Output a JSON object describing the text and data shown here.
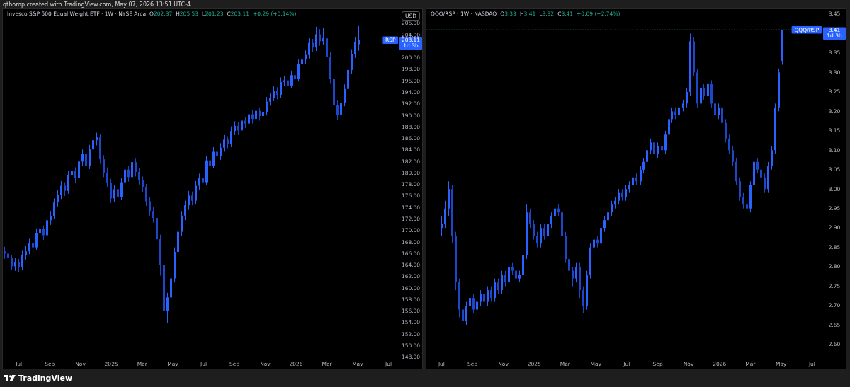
{
  "header": {
    "text": "qthomp created with TradingView.com, May 07, 2026 13:51 UTC-4"
  },
  "panels": [
    {
      "legend": {
        "title": "Invesco S&P 500 Equal Weight ETF · 1W · NYSE Arca",
        "values": [
          {
            "key": "O",
            "value": "202.37"
          },
          {
            "key": "H",
            "value": "205.53"
          },
          {
            "key": "L",
            "value": "201.23"
          },
          {
            "key": "C",
            "value": "203.11"
          }
        ],
        "change": "+0.29 (+0.14%)"
      },
      "currency_button": "USD",
      "price_tag": {
        "symbol": "RSP",
        "price": "203.11",
        "countdown": "1d 3h"
      },
      "chart_data": {
        "type": "candlestick",
        "x": [
          2024.421,
          2024.44,
          2024.459,
          2024.478,
          2024.498,
          2024.517,
          2024.536,
          2024.555,
          2024.574,
          2024.593,
          2024.613,
          2024.632,
          2024.651,
          2024.67,
          2024.689,
          2024.708,
          2024.728,
          2024.747,
          2024.766,
          2024.785,
          2024.804,
          2024.823,
          2024.843,
          2024.862,
          2024.881,
          2024.9,
          2024.919,
          2024.938,
          2024.957,
          2024.977,
          2024.996,
          2025.015,
          2025.034,
          2025.053,
          2025.072,
          2025.092,
          2025.111,
          2025.13,
          2025.149,
          2025.168,
          2025.187,
          2025.207,
          2025.226,
          2025.245,
          2025.264,
          2025.283,
          2025.302,
          2025.322,
          2025.341,
          2025.36,
          2025.379,
          2025.398,
          2025.417,
          2025.436,
          2025.456,
          2025.475,
          2025.494,
          2025.513,
          2025.532,
          2025.551,
          2025.571,
          2025.59,
          2025.609,
          2025.628,
          2025.647,
          2025.666,
          2025.686,
          2025.705,
          2025.724,
          2025.743,
          2025.762,
          2025.781,
          2025.801,
          2025.82,
          2025.839,
          2025.858,
          2025.877,
          2025.896,
          2025.915,
          2025.935,
          2025.954,
          2025.973,
          2025.992,
          2026.011,
          2026.03,
          2026.05,
          2026.069,
          2026.088,
          2026.107,
          2026.126,
          2026.145,
          2026.165,
          2026.184,
          2026.203,
          2026.222,
          2026.241,
          2026.26,
          2026.28,
          2026.299,
          2026.318,
          2026.337
        ],
        "ohlc": [
          [
            166.4,
            167.2,
            165.1,
            166.0
          ],
          [
            166.0,
            166.9,
            164.6,
            165.2
          ],
          [
            165.2,
            165.8,
            163.1,
            163.8
          ],
          [
            163.8,
            165.3,
            163.0,
            164.5
          ],
          [
            164.5,
            165.1,
            162.8,
            163.6
          ],
          [
            163.6,
            166.5,
            163.1,
            165.8
          ],
          [
            165.8,
            167.3,
            165.0,
            166.4
          ],
          [
            166.4,
            168.6,
            165.9,
            167.9
          ],
          [
            167.9,
            168.5,
            166.2,
            167.1
          ],
          [
            167.1,
            170.4,
            166.6,
            169.6
          ],
          [
            169.6,
            171.2,
            168.8,
            170.3
          ],
          [
            170.3,
            170.9,
            168.4,
            169.2
          ],
          [
            169.2,
            172.5,
            168.7,
            171.8
          ],
          [
            171.8,
            173.4,
            171.0,
            172.5
          ],
          [
            172.5,
            175.6,
            172.0,
            174.9
          ],
          [
            174.9,
            177.1,
            174.2,
            176.2
          ],
          [
            176.2,
            178.6,
            175.5,
            177.8
          ],
          [
            177.8,
            178.4,
            176.0,
            176.9
          ],
          [
            176.9,
            180.3,
            176.4,
            179.6
          ],
          [
            179.6,
            181.2,
            178.8,
            180.4
          ],
          [
            180.4,
            181.0,
            178.2,
            179.1
          ],
          [
            179.1,
            182.8,
            178.6,
            182.0
          ],
          [
            182.0,
            184.1,
            181.3,
            183.3
          ],
          [
            183.3,
            183.9,
            180.5,
            181.2
          ],
          [
            181.2,
            184.9,
            180.7,
            184.1
          ],
          [
            184.1,
            186.5,
            183.4,
            185.7
          ],
          [
            185.7,
            187.0,
            184.8,
            186.2
          ],
          [
            186.2,
            186.8,
            181.6,
            182.4
          ],
          [
            182.4,
            183.1,
            179.3,
            180.1
          ],
          [
            180.1,
            181.0,
            177.5,
            178.3
          ],
          [
            178.3,
            179.0,
            174.8,
            175.6
          ],
          [
            175.6,
            178.0,
            175.0,
            177.2
          ],
          [
            177.2,
            177.9,
            175.1,
            175.9
          ],
          [
            175.9,
            179.2,
            175.3,
            178.4
          ],
          [
            178.4,
            181.4,
            177.8,
            180.6
          ],
          [
            180.6,
            181.2,
            178.5,
            179.3
          ],
          [
            179.3,
            182.7,
            178.8,
            181.9
          ],
          [
            181.9,
            182.5,
            179.4,
            180.2
          ],
          [
            180.2,
            180.9,
            178.0,
            178.8
          ],
          [
            178.8,
            179.4,
            176.7,
            177.5
          ],
          [
            177.5,
            178.1,
            174.3,
            175.1
          ],
          [
            175.1,
            175.8,
            172.6,
            173.4
          ],
          [
            173.4,
            174.1,
            171.4,
            172.2
          ],
          [
            172.2,
            173.0,
            167.7,
            168.5
          ],
          [
            168.5,
            169.3,
            162.2,
            164.0
          ],
          [
            164.0,
            164.8,
            150.6,
            156.1
          ],
          [
            156.1,
            159.2,
            153.9,
            158.4
          ],
          [
            158.4,
            162.5,
            157.6,
            161.7
          ],
          [
            161.7,
            167.1,
            161.0,
            166.3
          ],
          [
            166.3,
            170.6,
            165.5,
            169.8
          ],
          [
            169.8,
            173.4,
            169.0,
            172.6
          ],
          [
            172.6,
            175.2,
            171.8,
            174.4
          ],
          [
            174.4,
            176.9,
            173.6,
            176.1
          ],
          [
            176.1,
            176.8,
            174.4,
            175.2
          ],
          [
            175.2,
            178.6,
            174.6,
            177.8
          ],
          [
            177.8,
            179.9,
            177.0,
            179.1
          ],
          [
            179.1,
            179.8,
            177.6,
            178.4
          ],
          [
            178.4,
            183.0,
            177.9,
            182.2
          ],
          [
            182.2,
            182.9,
            180.5,
            181.3
          ],
          [
            181.3,
            184.5,
            180.8,
            183.7
          ],
          [
            183.7,
            184.3,
            182.1,
            182.9
          ],
          [
            182.9,
            185.2,
            182.3,
            184.4
          ],
          [
            184.4,
            186.6,
            183.7,
            185.8
          ],
          [
            185.8,
            186.4,
            184.3,
            185.1
          ],
          [
            185.1,
            188.1,
            184.5,
            187.3
          ],
          [
            187.3,
            189.0,
            186.6,
            188.2
          ],
          [
            188.2,
            188.9,
            186.6,
            187.4
          ],
          [
            187.4,
            189.9,
            186.8,
            189.1
          ],
          [
            189.1,
            189.7,
            187.8,
            188.6
          ],
          [
            188.6,
            191.0,
            188.0,
            190.2
          ],
          [
            190.2,
            190.9,
            188.6,
            189.4
          ],
          [
            189.4,
            191.6,
            188.8,
            190.8
          ],
          [
            190.8,
            191.4,
            189.1,
            189.9
          ],
          [
            189.9,
            191.4,
            189.3,
            190.6
          ],
          [
            190.6,
            193.2,
            190.0,
            192.4
          ],
          [
            192.4,
            193.9,
            191.7,
            193.1
          ],
          [
            193.1,
            195.1,
            192.5,
            194.3
          ],
          [
            194.3,
            194.9,
            192.8,
            193.6
          ],
          [
            193.6,
            196.6,
            193.0,
            195.8
          ],
          [
            195.8,
            196.9,
            195.1,
            196.1
          ],
          [
            196.1,
            196.8,
            194.4,
            195.2
          ],
          [
            195.2,
            197.8,
            194.7,
            197.0
          ],
          [
            197.0,
            197.7,
            195.6,
            196.4
          ],
          [
            196.4,
            199.7,
            195.9,
            198.9
          ],
          [
            198.9,
            200.5,
            198.1,
            199.7
          ],
          [
            199.7,
            201.3,
            199.0,
            200.5
          ],
          [
            200.5,
            203.4,
            199.9,
            202.6
          ],
          [
            202.6,
            203.3,
            201.0,
            201.8
          ],
          [
            201.8,
            205.4,
            201.2,
            204.1
          ],
          [
            204.1,
            205.0,
            202.1,
            202.9
          ],
          [
            202.9,
            205.2,
            202.2,
            203.4
          ],
          [
            203.4,
            204.1,
            199.4,
            200.2
          ],
          [
            200.2,
            201.0,
            195.5,
            196.3
          ],
          [
            196.3,
            197.1,
            191.0,
            191.8
          ],
          [
            191.8,
            192.6,
            189.3,
            190.1
          ],
          [
            190.1,
            193.0,
            188.0,
            192.2
          ],
          [
            192.2,
            195.4,
            191.6,
            194.6
          ],
          [
            194.6,
            198.7,
            194.0,
            197.9
          ],
          [
            197.9,
            201.5,
            197.2,
            200.7
          ],
          [
            200.7,
            203.6,
            200.0,
            202.8
          ],
          [
            202.37,
            205.53,
            201.23,
            203.11
          ]
        ],
        "xlim": [
          2024.413,
          2026.548
        ],
        "ylim": [
          148,
          206
        ],
        "ref_lines": [
          {
            "axis": "y",
            "value": 203.11
          }
        ],
        "xticks": [
          {
            "value": 2024.5,
            "label": "Jul"
          },
          {
            "value": 2024.667,
            "label": "Sep"
          },
          {
            "value": 2024.833,
            "label": "Nov"
          },
          {
            "value": 2025,
            "label": "2025"
          },
          {
            "value": 2025.167,
            "label": "Mar"
          },
          {
            "value": 2025.333,
            "label": "May"
          },
          {
            "value": 2025.5,
            "label": "Jul"
          },
          {
            "value": 2025.667,
            "label": "Sep"
          },
          {
            "value": 2025.833,
            "label": "Nov"
          },
          {
            "value": 2026,
            "label": "2026"
          },
          {
            "value": 2026.167,
            "label": "Mar"
          },
          {
            "value": 2026.333,
            "label": "May"
          },
          {
            "value": 2026.5,
            "label": "Jul"
          }
        ],
        "yticks": [
          {
            "value": 206,
            "label": "206.00"
          },
          {
            "value": 204,
            "label": "204.00"
          },
          {
            "value": 200,
            "label": "200.00"
          },
          {
            "value": 198,
            "label": "198.00"
          },
          {
            "value": 196,
            "label": "196.00"
          },
          {
            "value": 194,
            "label": "194.00"
          },
          {
            "value": 192,
            "label": "192.00"
          },
          {
            "value": 190,
            "label": "190.00"
          },
          {
            "value": 188,
            "label": "188.00"
          },
          {
            "value": 186,
            "label": "186.00"
          },
          {
            "value": 184,
            "label": "184.00"
          },
          {
            "value": 182,
            "label": "182.00"
          },
          {
            "value": 180,
            "label": "180.00"
          },
          {
            "value": 178,
            "label": "178.00"
          },
          {
            "value": 176,
            "label": "176.00"
          },
          {
            "value": 174,
            "label": "174.00"
          },
          {
            "value": 172,
            "label": "172.00"
          },
          {
            "value": 170,
            "label": "170.00"
          },
          {
            "value": 168,
            "label": "168.00"
          },
          {
            "value": 166,
            "label": "166.00"
          },
          {
            "value": 164,
            "label": "164.00"
          },
          {
            "value": 162,
            "label": "162.00"
          },
          {
            "value": 160,
            "label": "160.00"
          },
          {
            "value": 158,
            "label": "158.00"
          },
          {
            "value": 156,
            "label": "156.00"
          },
          {
            "value": 154,
            "label": "154.00"
          },
          {
            "value": 152,
            "label": "152.00"
          },
          {
            "value": 150,
            "label": "150.00"
          },
          {
            "value": 148,
            "label": "148.00"
          }
        ]
      }
    },
    {
      "legend": {
        "title": "QQQ/RSP · 1W · NASDAQ",
        "values": [
          {
            "key": "O",
            "value": "3.33"
          },
          {
            "key": "H",
            "value": "3.41"
          },
          {
            "key": "L",
            "value": "3.32"
          },
          {
            "key": "C",
            "value": "3.41"
          }
        ],
        "change": "+0.09 (+2.74%)"
      },
      "price_tag": {
        "symbol": "QQQ/RSP",
        "price": "3.41",
        "countdown": "1d 3h"
      },
      "chart_data": {
        "type": "candlestick",
        "x": [
          2024.498,
          2024.517,
          2024.536,
          2024.555,
          2024.574,
          2024.593,
          2024.613,
          2024.632,
          2024.651,
          2024.67,
          2024.689,
          2024.708,
          2024.728,
          2024.747,
          2024.766,
          2024.785,
          2024.804,
          2024.823,
          2024.843,
          2024.862,
          2024.881,
          2024.9,
          2024.919,
          2024.938,
          2024.957,
          2024.977,
          2024.996,
          2025.015,
          2025.034,
          2025.053,
          2025.072,
          2025.092,
          2025.111,
          2025.13,
          2025.149,
          2025.168,
          2025.187,
          2025.207,
          2025.226,
          2025.245,
          2025.264,
          2025.283,
          2025.302,
          2025.322,
          2025.341,
          2025.36,
          2025.379,
          2025.398,
          2025.417,
          2025.436,
          2025.456,
          2025.475,
          2025.494,
          2025.513,
          2025.532,
          2025.551,
          2025.571,
          2025.59,
          2025.609,
          2025.628,
          2025.647,
          2025.666,
          2025.686,
          2025.705,
          2025.724,
          2025.743,
          2025.762,
          2025.781,
          2025.801,
          2025.82,
          2025.839,
          2025.858,
          2025.877,
          2025.896,
          2025.915,
          2025.935,
          2025.954,
          2025.973,
          2025.992,
          2026.011,
          2026.03,
          2026.05,
          2026.069,
          2026.088,
          2026.107,
          2026.126,
          2026.145,
          2026.165,
          2026.184,
          2026.203,
          2026.222,
          2026.241,
          2026.26,
          2026.28,
          2026.299,
          2026.318,
          2026.337
        ],
        "ohlc": [
          [
            2.9,
            2.93,
            2.88,
            2.91
          ],
          [
            2.91,
            2.97,
            2.9,
            2.95
          ],
          [
            2.95,
            3.02,
            2.93,
            3.0
          ],
          [
            3.0,
            3.01,
            2.86,
            2.88
          ],
          [
            2.88,
            2.89,
            2.74,
            2.76
          ],
          [
            2.76,
            2.77,
            2.67,
            2.69
          ],
          [
            2.69,
            2.7,
            2.63,
            2.66
          ],
          [
            2.66,
            2.71,
            2.65,
            2.7
          ],
          [
            2.7,
            2.74,
            2.69,
            2.72
          ],
          [
            2.72,
            2.73,
            2.68,
            2.69
          ],
          [
            2.69,
            2.72,
            2.68,
            2.71
          ],
          [
            2.71,
            2.74,
            2.7,
            2.73
          ],
          [
            2.73,
            2.74,
            2.7,
            2.71
          ],
          [
            2.71,
            2.75,
            2.7,
            2.74
          ],
          [
            2.74,
            2.75,
            2.71,
            2.72
          ],
          [
            2.72,
            2.77,
            2.71,
            2.76
          ],
          [
            2.76,
            2.77,
            2.73,
            2.74
          ],
          [
            2.74,
            2.79,
            2.73,
            2.78
          ],
          [
            2.78,
            2.79,
            2.75,
            2.76
          ],
          [
            2.76,
            2.81,
            2.75,
            2.8
          ],
          [
            2.8,
            2.81,
            2.78,
            2.79
          ],
          [
            2.79,
            2.8,
            2.76,
            2.77
          ],
          [
            2.77,
            2.79,
            2.76,
            2.78
          ],
          [
            2.78,
            2.84,
            2.77,
            2.83
          ],
          [
            2.83,
            2.96,
            2.82,
            2.94
          ],
          [
            2.94,
            2.95,
            2.9,
            2.91
          ],
          [
            2.91,
            2.92,
            2.87,
            2.88
          ],
          [
            2.88,
            2.89,
            2.85,
            2.86
          ],
          [
            2.86,
            2.91,
            2.85,
            2.9
          ],
          [
            2.9,
            2.91,
            2.87,
            2.88
          ],
          [
            2.88,
            2.92,
            2.87,
            2.91
          ],
          [
            2.91,
            2.94,
            2.9,
            2.93
          ],
          [
            2.93,
            2.97,
            2.92,
            2.95
          ],
          [
            2.95,
            2.96,
            2.93,
            2.94
          ],
          [
            2.94,
            2.95,
            2.87,
            2.88
          ],
          [
            2.88,
            2.89,
            2.81,
            2.82
          ],
          [
            2.82,
            2.83,
            2.78,
            2.79
          ],
          [
            2.79,
            2.8,
            2.75,
            2.77
          ],
          [
            2.77,
            2.81,
            2.76,
            2.8
          ],
          [
            2.8,
            2.81,
            2.72,
            2.74
          ],
          [
            2.74,
            2.75,
            2.68,
            2.7
          ],
          [
            2.7,
            2.79,
            2.69,
            2.78
          ],
          [
            2.78,
            2.86,
            2.77,
            2.85
          ],
          [
            2.85,
            2.88,
            2.84,
            2.87
          ],
          [
            2.87,
            2.88,
            2.85,
            2.86
          ],
          [
            2.86,
            2.91,
            2.85,
            2.9
          ],
          [
            2.9,
            2.93,
            2.89,
            2.92
          ],
          [
            2.92,
            2.95,
            2.91,
            2.94
          ],
          [
            2.94,
            2.97,
            2.93,
            2.96
          ],
          [
            2.96,
            2.98,
            2.95,
            2.97
          ],
          [
            2.97,
            3.0,
            2.96,
            2.99
          ],
          [
            2.99,
            3.0,
            2.97,
            2.98
          ],
          [
            2.98,
            3.01,
            2.97,
            3.0
          ],
          [
            3.0,
            3.02,
            2.99,
            3.01
          ],
          [
            3.01,
            3.04,
            3.0,
            3.03
          ],
          [
            3.03,
            3.04,
            3.01,
            3.02
          ],
          [
            3.02,
            3.06,
            3.01,
            3.05
          ],
          [
            3.05,
            3.08,
            3.04,
            3.07
          ],
          [
            3.07,
            3.11,
            3.06,
            3.1
          ],
          [
            3.1,
            3.13,
            3.09,
            3.12
          ],
          [
            3.12,
            3.13,
            3.08,
            3.09
          ],
          [
            3.09,
            3.12,
            3.08,
            3.11
          ],
          [
            3.11,
            3.12,
            3.09,
            3.1
          ],
          [
            3.1,
            3.15,
            3.09,
            3.14
          ],
          [
            3.14,
            3.19,
            3.13,
            3.18
          ],
          [
            3.18,
            3.21,
            3.17,
            3.2
          ],
          [
            3.2,
            3.21,
            3.18,
            3.19
          ],
          [
            3.19,
            3.22,
            3.18,
            3.21
          ],
          [
            3.21,
            3.23,
            3.2,
            3.22
          ],
          [
            3.22,
            3.26,
            3.21,
            3.25
          ],
          [
            3.25,
            3.4,
            3.24,
            3.38
          ],
          [
            3.38,
            3.39,
            3.29,
            3.3
          ],
          [
            3.3,
            3.31,
            3.21,
            3.22
          ],
          [
            3.22,
            3.27,
            3.21,
            3.26
          ],
          [
            3.26,
            3.27,
            3.23,
            3.24
          ],
          [
            3.24,
            3.28,
            3.23,
            3.27
          ],
          [
            3.27,
            3.28,
            3.21,
            3.22
          ],
          [
            3.22,
            3.23,
            3.18,
            3.19
          ],
          [
            3.19,
            3.22,
            3.18,
            3.21
          ],
          [
            3.21,
            3.22,
            3.16,
            3.17
          ],
          [
            3.17,
            3.18,
            3.12,
            3.13
          ],
          [
            3.13,
            3.14,
            3.09,
            3.1
          ],
          [
            3.1,
            3.11,
            3.06,
            3.07
          ],
          [
            3.07,
            3.08,
            3.01,
            3.02
          ],
          [
            3.02,
            3.03,
            2.97,
            2.98
          ],
          [
            2.98,
            2.99,
            2.95,
            2.96
          ],
          [
            2.96,
            2.97,
            2.94,
            2.95
          ],
          [
            2.95,
            3.02,
            2.94,
            3.01
          ],
          [
            3.01,
            3.08,
            3.0,
            3.07
          ],
          [
            3.07,
            3.08,
            3.04,
            3.05
          ],
          [
            3.05,
            3.06,
            3.02,
            3.03
          ],
          [
            3.03,
            3.04,
            2.99,
            3.0
          ],
          [
            3.0,
            3.07,
            2.99,
            3.06
          ],
          [
            3.06,
            3.11,
            3.05,
            3.1
          ],
          [
            3.1,
            3.22,
            3.09,
            3.21
          ],
          [
            3.21,
            3.31,
            3.2,
            3.3
          ],
          [
            3.33,
            3.41,
            3.32,
            3.41
          ]
        ],
        "xlim": [
          2024.418,
          2026.548
        ],
        "ylim": [
          2.6,
          3.45
        ],
        "ref_lines": [
          {
            "axis": "y",
            "value": 3.41
          }
        ],
        "xticks": [
          {
            "value": 2024.5,
            "label": "Jul"
          },
          {
            "value": 2024.667,
            "label": "Sep"
          },
          {
            "value": 2024.833,
            "label": "Nov"
          },
          {
            "value": 2025,
            "label": "2025"
          },
          {
            "value": 2025.167,
            "label": "Mar"
          },
          {
            "value": 2025.333,
            "label": "May"
          },
          {
            "value": 2025.5,
            "label": "Jul"
          },
          {
            "value": 2025.667,
            "label": "Sep"
          },
          {
            "value": 2025.833,
            "label": "Nov"
          },
          {
            "value": 2026,
            "label": "2026"
          },
          {
            "value": 2026.167,
            "label": "Mar"
          },
          {
            "value": 2026.333,
            "label": "May"
          },
          {
            "value": 2026.5,
            "label": "Jul"
          }
        ],
        "yticks": [
          {
            "value": 3.45,
            "label": "3.45"
          },
          {
            "value": 3.35,
            "label": "3.35"
          },
          {
            "value": 3.3,
            "label": "3.30"
          },
          {
            "value": 3.25,
            "label": "3.25"
          },
          {
            "value": 3.2,
            "label": "3.20"
          },
          {
            "value": 3.15,
            "label": "3.15"
          },
          {
            "value": 3.1,
            "label": "3.10"
          },
          {
            "value": 3.05,
            "label": "3.05"
          },
          {
            "value": 3.0,
            "label": "3.00"
          },
          {
            "value": 2.95,
            "label": "2.95"
          },
          {
            "value": 2.9,
            "label": "2.90"
          },
          {
            "value": 2.85,
            "label": "2.85"
          },
          {
            "value": 2.8,
            "label": "2.80"
          },
          {
            "value": 2.75,
            "label": "2.75"
          },
          {
            "value": 2.7,
            "label": "2.70"
          },
          {
            "value": 2.65,
            "label": "2.65"
          },
          {
            "value": 2.6,
            "label": "2.60"
          }
        ]
      }
    }
  ],
  "footer": {
    "brand": "TradingView"
  }
}
